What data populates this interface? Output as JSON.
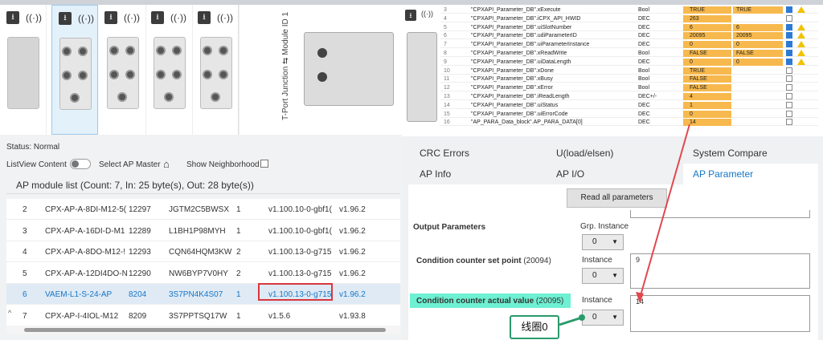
{
  "status": "Status: Normal",
  "listview": {
    "content_label": "ListView Content",
    "ap_master_label": "Select AP Master",
    "neighborhood_label": "Show Neighborhood"
  },
  "module_list": {
    "header": "AP module list (Count: 7, In: 25 byte(s), Out: 28 byte(s))",
    "rows": [
      {
        "no": "2",
        "type": "CPX-AP-A-8DI-M12-5(",
        "id": "12297",
        "serial": "JGTM2C5BWSX",
        "slot": "1",
        "fw": "v1.100.10-0-gbf1(",
        "ver": "v1.96.2"
      },
      {
        "no": "3",
        "type": "CPX-AP-A-16DI-D-M1",
        "id": "12289",
        "serial": "L1BH1P98MYH",
        "slot": "1",
        "fw": "v1.100.10-0-gbf1(",
        "ver": "v1.96.2"
      },
      {
        "no": "4",
        "type": "CPX-AP-A-8DO-M12-!",
        "id": "12293",
        "serial": "CQN64HQM3KW",
        "slot": "2",
        "fw": "v1.100.13-0-g715",
        "ver": "v1.96.2"
      },
      {
        "no": "5",
        "type": "CPX-AP-A-12DI4DO-N",
        "id": "12290",
        "serial": "NW6BYP7V0HY",
        "slot": "2",
        "fw": "v1.100.13-0-g715",
        "ver": "v1.96.2"
      },
      {
        "no": "6",
        "type": "VAEM-L1-S-24-AP",
        "id": "8204",
        "serial": "3S7PN4K4S07",
        "slot": "1",
        "fw": "v1.100.13-0-g715",
        "ver": "v1.96.2"
      },
      {
        "no": "7",
        "type": "CPX-AP-I-4IOL-M12",
        "id": "8209",
        "serial": "3S7PPTSQ17W",
        "slot": "1",
        "fw": "v1.5.6",
        "ver": "v1.93.8"
      }
    ]
  },
  "junction_label": "T-Port Junction ⇆ Module ID 1",
  "tabs": {
    "row1": [
      "CRC Errors",
      "U(load/elsen)",
      "System Compare"
    ],
    "row2": [
      "AP Info",
      "AP I/O",
      "AP Parameter"
    ]
  },
  "parameters": {
    "read_all_label": "Read all parameters",
    "output_params_label": "Output Parameters",
    "grp_instance_label": "Grp. Instance",
    "grp_instance_value": "0",
    "set_point_label": "Condition counter set point",
    "set_point_id": "(20094)",
    "set_point_instance_label": "Instance",
    "set_point_instance_value": "0",
    "set_point_value": "9",
    "actual_label": "Condition counter actual value",
    "actual_id": "(20095)",
    "actual_instance_label": "Instance",
    "actual_instance_value": "0",
    "actual_value": "14"
  },
  "callout": "线圈0",
  "watch_table": [
    {
      "n": "3",
      "name": "\"CPXAPI_Parameter_DB\".xExecute",
      "type": "Bool",
      "val": "TRUE",
      "mod": "TRUE",
      "on": true,
      "warn": true
    },
    {
      "n": "4",
      "name": "\"CPXAPI_Parameter_DB\".iCPX_API_HWID",
      "type": "DEC",
      "val": "263",
      "mod": "",
      "on": false,
      "warn": false
    },
    {
      "n": "5",
      "name": "\"CPXAPI_Parameter_DB\".uiSlotNumber",
      "type": "DEC",
      "val": "6",
      "mod": "6",
      "on": true,
      "warn": true
    },
    {
      "n": "6",
      "name": "\"CPXAPI_Parameter_DB\".udiParameterID",
      "type": "DEC",
      "val": "20095",
      "mod": "20095",
      "on": true,
      "warn": true
    },
    {
      "n": "7",
      "name": "\"CPXAPI_Parameter_DB\".uiParameterInstance",
      "type": "DEC",
      "val": "0",
      "mod": "0",
      "on": true,
      "warn": true
    },
    {
      "n": "8",
      "name": "\"CPXAPI_Parameter_DB\".xReadWrite",
      "type": "Bool",
      "val": "FALSE",
      "mod": "FALSE",
      "on": true,
      "warn": true
    },
    {
      "n": "9",
      "name": "\"CPXAPI_Parameter_DB\".uiDataLength",
      "type": "DEC",
      "val": "0",
      "mod": "0",
      "on": true,
      "warn": true
    },
    {
      "n": "10",
      "name": "\"CPXAPI_Parameter_DB\".xDone",
      "type": "Bool",
      "val": "TRUE",
      "mod": "",
      "on": false,
      "warn": false
    },
    {
      "n": "11",
      "name": "\"CPXAPI_Parameter_DB\".xBusy",
      "type": "Bool",
      "val": "FALSE",
      "mod": "",
      "on": false,
      "warn": false
    },
    {
      "n": "12",
      "name": "\"CPXAPI_Parameter_DB\".xError",
      "type": "Bool",
      "val": "FALSE",
      "mod": "",
      "on": false,
      "warn": false
    },
    {
      "n": "13",
      "name": "\"CPXAPI_Parameter_DB\".iReadLength",
      "type": "DEC+/-",
      "val": "4",
      "mod": "",
      "on": false,
      "warn": false
    },
    {
      "n": "14",
      "name": "\"CPXAPI_Parameter_DB\".uiStatus",
      "type": "DEC",
      "val": "1",
      "mod": "",
      "on": false,
      "warn": false
    },
    {
      "n": "15",
      "name": "\"CPXAPI_Parameter_DB\".uiErrorCode",
      "type": "DEC",
      "val": "0",
      "mod": "",
      "on": false,
      "warn": false
    },
    {
      "n": "16",
      "name": "\"AP_PARA_Data_block\".AP_PARA_DATA[0]",
      "type": "DEC",
      "val": "14",
      "mod": "",
      "on": false,
      "warn": false
    }
  ],
  "colors": {
    "accent": "#1676c7",
    "highlight": "#6ef0d2",
    "orange": "#f7b94d",
    "red": "#d9363e",
    "green": "#2a9a6a"
  }
}
